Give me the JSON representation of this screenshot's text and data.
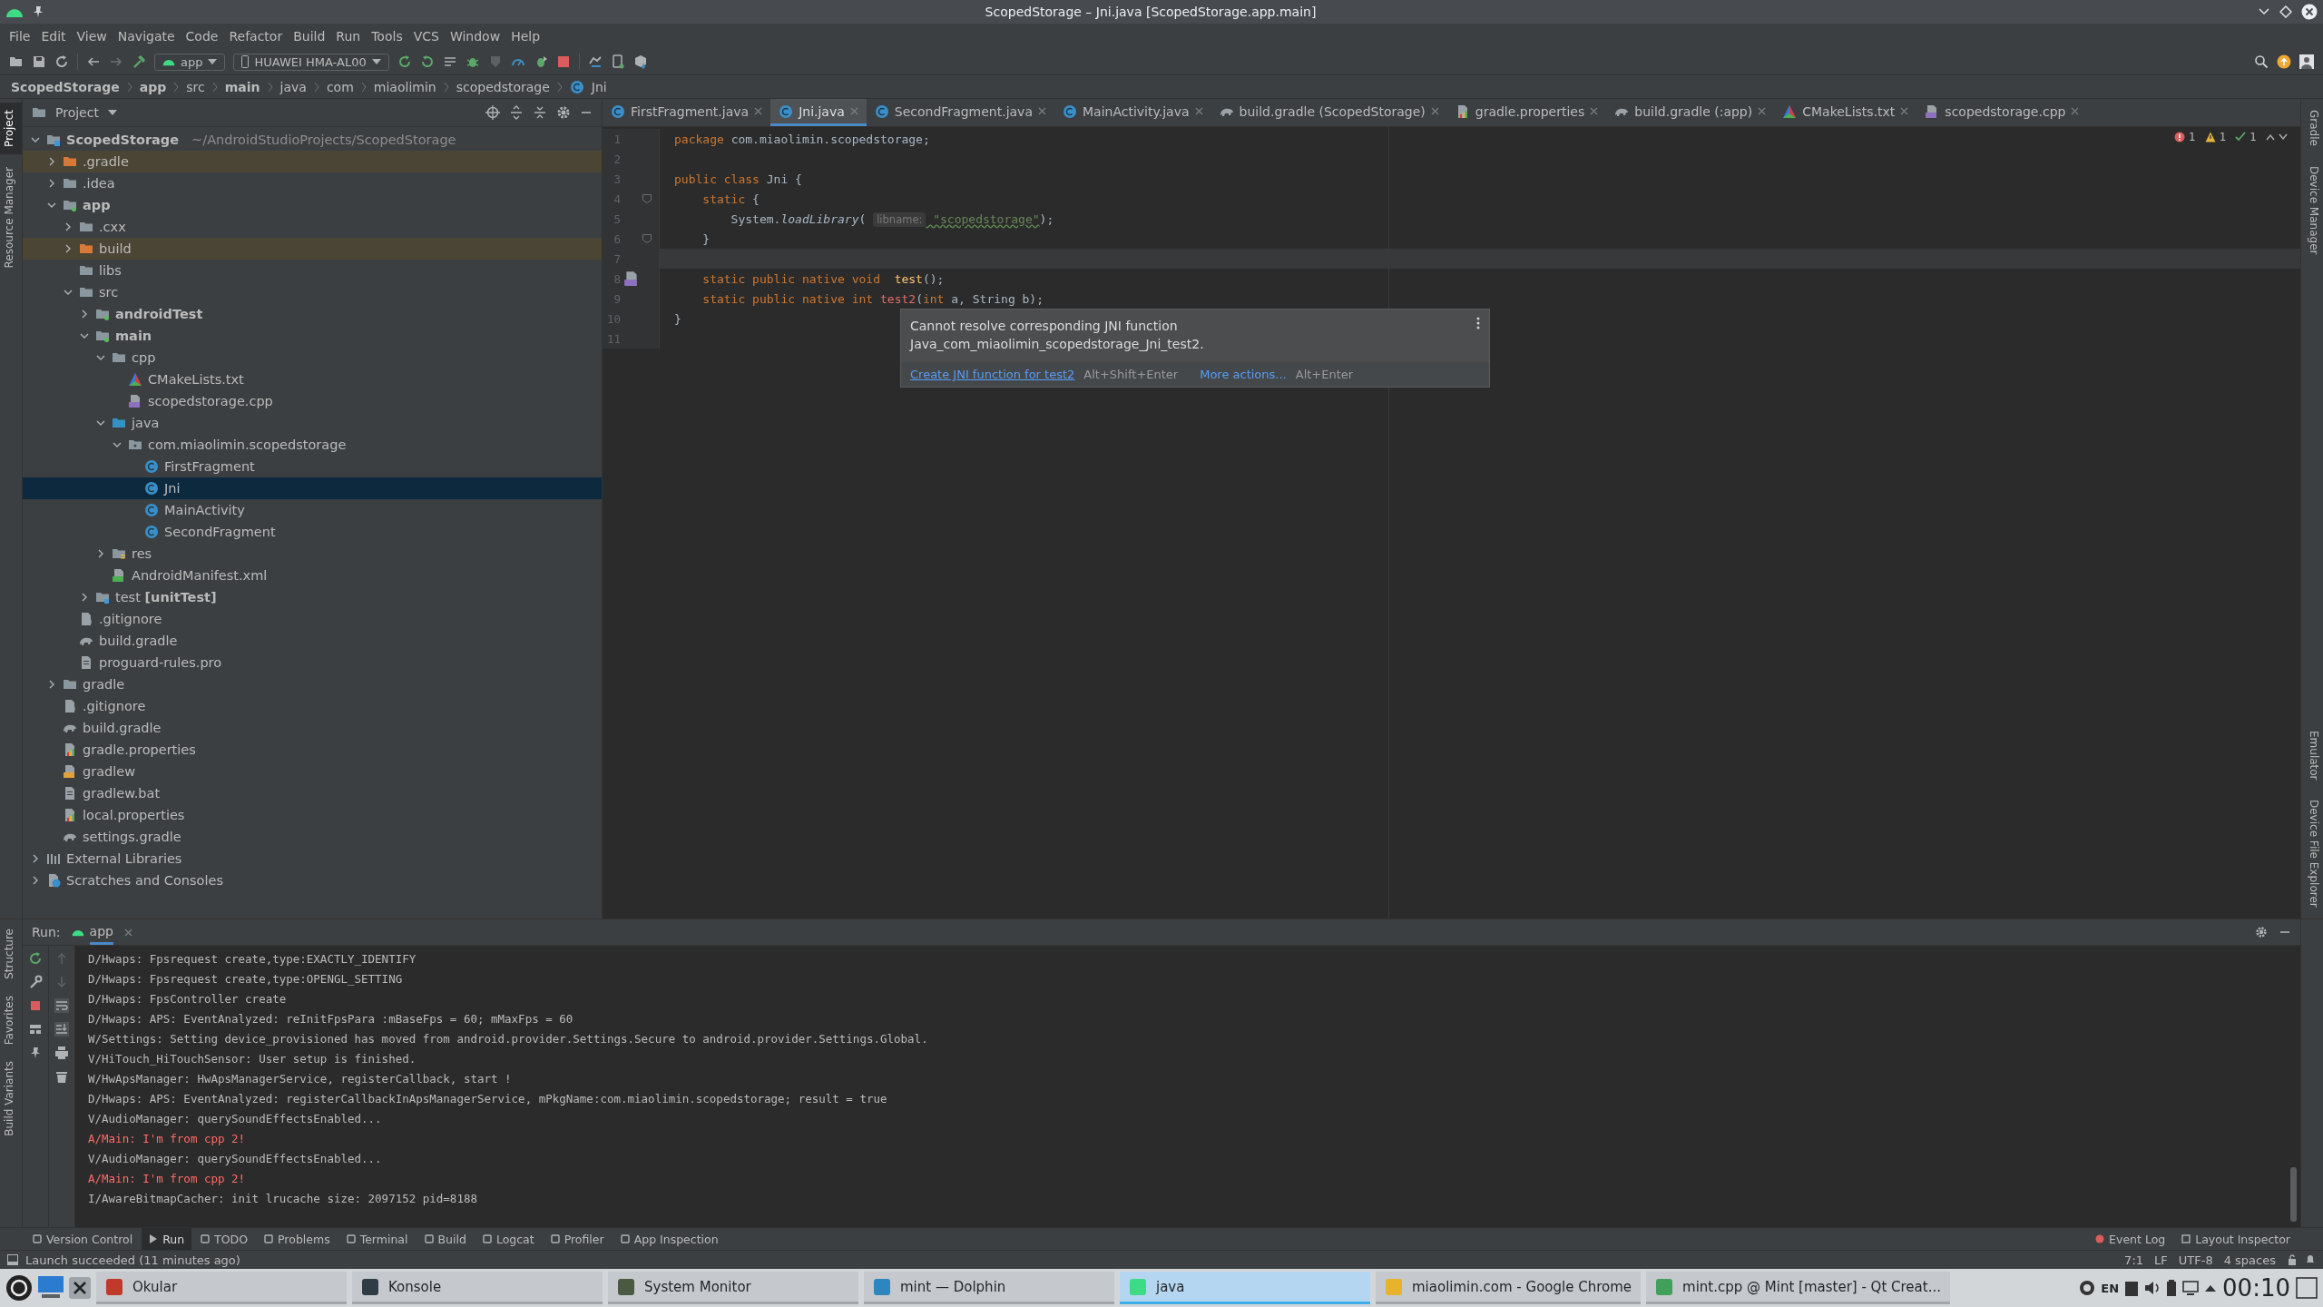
{
  "window": {
    "title": "ScopedStorage – Jni.java [ScopedStorage.app.main]"
  },
  "menu": [
    "File",
    "Edit",
    "View",
    "Navigate",
    "Code",
    "Refactor",
    "Build",
    "Run",
    "Tools",
    "VCS",
    "Window",
    "Help"
  ],
  "toolbar": {
    "run_config": "app",
    "device": "HUAWEI HMA-AL00"
  },
  "breadcrumb": [
    {
      "label": "ScopedStorage",
      "bold": true
    },
    {
      "label": "app",
      "bold": true
    },
    {
      "label": "src",
      "bold": false
    },
    {
      "label": "main",
      "bold": true
    },
    {
      "label": "java",
      "bold": false
    },
    {
      "label": "com",
      "bold": false
    },
    {
      "label": "miaolimin",
      "bold": false
    },
    {
      "label": "scopedstorage",
      "bold": false
    },
    {
      "label": "Jni",
      "bold": false,
      "kind": "class"
    }
  ],
  "left_stripe": {
    "top": [
      {
        "label": "Project",
        "selected": true
      },
      {
        "label": "Resource Manager",
        "selected": false
      }
    ],
    "bottom": [
      {
        "label": "Structure",
        "selected": false
      },
      {
        "label": "Favorites",
        "selected": false
      },
      {
        "label": "Build Variants",
        "selected": false
      }
    ]
  },
  "right_stripe": {
    "top": [
      "Gradle",
      "Device Manager"
    ],
    "bottom": [
      "Emulator",
      "Device File Explorer"
    ]
  },
  "project": {
    "title": "Project",
    "items": [
      {
        "label": "ScopedStorage",
        "hint": "~/AndroidStudioProjects/ScopedStorage",
        "kind": "module",
        "bold": true,
        "expanded": true,
        "selected": false,
        "children": [
          {
            "label": ".gradle",
            "kind": "folder-excluded",
            "excluded": true,
            "expanded": false,
            "selected": false
          },
          {
            "label": ".idea",
            "kind": "folder",
            "expanded": false,
            "selected": false
          },
          {
            "label": "app",
            "kind": "module-source",
            "bold": true,
            "expanded": true,
            "selected": false,
            "children": [
              {
                "label": ".cxx",
                "kind": "folder",
                "expanded": false,
                "selected": false
              },
              {
                "label": "build",
                "kind": "folder-excluded",
                "excluded": true,
                "expanded": false,
                "selected": false
              },
              {
                "label": "libs",
                "kind": "folder",
                "selected": false
              },
              {
                "label": "src",
                "kind": "folder",
                "expanded": true,
                "selected": false,
                "children": [
                  {
                    "label": "androidTest",
                    "kind": "module-source",
                    "bold": true,
                    "expanded": false,
                    "selected": false
                  },
                  {
                    "label": "main",
                    "kind": "module-source",
                    "bold": true,
                    "expanded": true,
                    "selected": false,
                    "children": [
                      {
                        "label": "cpp",
                        "kind": "folder",
                        "expanded": true,
                        "selected": false,
                        "children": [
                          {
                            "label": "CMakeLists.txt",
                            "kind": "cmake",
                            "selected": false
                          },
                          {
                            "label": "scopedstorage.cpp",
                            "kind": "cpp",
                            "selected": false
                          }
                        ]
                      },
                      {
                        "label": "java",
                        "kind": "folder-source",
                        "expanded": true,
                        "selected": false,
                        "children": [
                          {
                            "label": "com.miaolimin.scopedstorage",
                            "kind": "package",
                            "expanded": true,
                            "selected": false,
                            "children": [
                              {
                                "label": "FirstFragment",
                                "kind": "class",
                                "selected": false
                              },
                              {
                                "label": "Jni",
                                "kind": "class",
                                "selected": true
                              },
                              {
                                "label": "MainActivity",
                                "kind": "class",
                                "selected": false
                              },
                              {
                                "label": "SecondFragment",
                                "kind": "class",
                                "selected": false
                              }
                            ]
                          }
                        ]
                      },
                      {
                        "label": "res",
                        "kind": "folder-res",
                        "expanded": false,
                        "selected": false
                      },
                      {
                        "label": "AndroidManifest.xml",
                        "kind": "manifest",
                        "selected": false
                      }
                    ]
                  },
                  {
                    "label": "test **[unitTest]**",
                    "kind": "module-test",
                    "expanded": false,
                    "selected": false
                  }
                ]
              },
              {
                "label": ".gitignore",
                "kind": "ignore",
                "selected": false
              },
              {
                "label": "build.gradle",
                "kind": "gradle",
                "selected": false
              },
              {
                "label": "proguard-rules.pro",
                "kind": "text",
                "selected": false
              }
            ]
          },
          {
            "label": "gradle",
            "kind": "folder",
            "expanded": false,
            "selected": false
          },
          {
            "label": ".gitignore",
            "kind": "ignore",
            "selected": false
          },
          {
            "label": "build.gradle",
            "kind": "gradle",
            "selected": false
          },
          {
            "label": "gradle.properties",
            "kind": "properties",
            "selected": false
          },
          {
            "label": "gradlew",
            "kind": "shell",
            "selected": false
          },
          {
            "label": "gradlew.bat",
            "kind": "text",
            "selected": false
          },
          {
            "label": "local.properties",
            "kind": "properties",
            "selected": false
          },
          {
            "label": "settings.gradle",
            "kind": "gradle",
            "selected": false
          }
        ]
      },
      {
        "label": "External Libraries",
        "kind": "libraries",
        "expanded": false,
        "selected": false
      },
      {
        "label": "Scratches and Consoles",
        "kind": "scratches",
        "expanded": false,
        "selected": false
      }
    ]
  },
  "tabs": [
    {
      "label": "FirstFragment.java",
      "kind": "class",
      "selected": false
    },
    {
      "label": "Jni.java",
      "kind": "class",
      "selected": true
    },
    {
      "label": "SecondFragment.java",
      "kind": "class",
      "selected": false
    },
    {
      "label": "MainActivity.java",
      "kind": "class",
      "selected": false
    },
    {
      "label": "build.gradle (ScopedStorage)",
      "kind": "gradle",
      "selected": false
    },
    {
      "label": "gradle.properties",
      "kind": "properties",
      "selected": false
    },
    {
      "label": "build.gradle (:app)",
      "kind": "gradle",
      "selected": false
    },
    {
      "label": "CMakeLists.txt",
      "kind": "cmake",
      "selected": false
    },
    {
      "label": "scopedstorage.cpp",
      "kind": "cpp",
      "selected": false
    }
  ],
  "inspections": {
    "errors": "1",
    "warnings": "1",
    "weak_warnings": "1"
  },
  "code": [
    {
      "number": "1",
      "tokens": [
        {
          "kind": "keyword",
          "text": "package "
        },
        {
          "kind": "plain",
          "text": "com.miaolimin.scopedstorage;"
        }
      ]
    },
    {
      "number": "2"
    },
    {
      "number": "3",
      "tokens": [
        {
          "kind": "keyword",
          "text": "public class "
        },
        {
          "kind": "plain",
          "text": "Jni {"
        }
      ]
    },
    {
      "number": "4",
      "fold": true,
      "tokens": [
        {
          "kind": "keyword",
          "text": "    static "
        },
        {
          "kind": "plain",
          "text": "{"
        }
      ]
    },
    {
      "number": "5",
      "tokens": [
        {
          "kind": "plain",
          "text": "        System."
        },
        {
          "kind": "static-call",
          "text": "loadLibrary"
        },
        {
          "kind": "plain",
          "text": "( "
        },
        {
          "kind": "hint",
          "text": "libname:"
        },
        {
          "kind": "string",
          "text": " \"scopedstorage\""
        },
        {
          "kind": "plain",
          "text": ");"
        }
      ]
    },
    {
      "number": "6",
      "fold": true,
      "tokens": [
        {
          "kind": "plain",
          "text": "    }"
        }
      ]
    },
    {
      "number": "7",
      "current": true
    },
    {
      "number": "8",
      "native_marker": true,
      "tokens": [
        {
          "kind": "keyword",
          "text": "    static public native void  "
        },
        {
          "kind": "function",
          "text": "test"
        },
        {
          "kind": "plain",
          "text": "();"
        }
      ]
    },
    {
      "number": "9",
      "tokens": [
        {
          "kind": "keyword",
          "text": "    static public native int "
        },
        {
          "kind": "error",
          "text": "test2"
        },
        {
          "kind": "plain",
          "text": "("
        },
        {
          "kind": "keyword",
          "text": "int "
        },
        {
          "kind": "plain",
          "text": "a, String b);"
        }
      ]
    },
    {
      "number": "10",
      "tokens": [
        {
          "kind": "plain",
          "text": "}"
        }
      ]
    },
    {
      "number": "11"
    }
  ],
  "popup": {
    "message": [
      "Cannot resolve corresponding JNI function",
      "Java_com_miaolimin_scopedstorage_Jni_test2."
    ],
    "actions": [
      {
        "label": "Create JNI function for test2",
        "shortcut": "Alt+Shift+Enter"
      },
      {
        "label": "More actions...",
        "shortcut": "Alt+Enter"
      }
    ]
  },
  "run": {
    "label": "Run:",
    "tab": "app",
    "log": [
      {
        "kind": "info",
        "text": "D/Hwaps: Fpsrequest create,type:EXACTLY_IDENTIFY"
      },
      {
        "kind": "info",
        "text": "D/Hwaps: Fpsrequest create,type:OPENGL_SETTING"
      },
      {
        "kind": "info",
        "text": "D/Hwaps: FpsController create"
      },
      {
        "kind": "info",
        "text": "D/Hwaps: APS: EventAnalyzed: reInitFpsPara :mBaseFps = 60; mMaxFps = 60"
      },
      {
        "kind": "info",
        "text": "W/Settings: Setting device_provisioned has moved from android.provider.Settings.Secure to android.provider.Settings.Global."
      },
      {
        "kind": "info",
        "text": "V/HiTouch_HiTouchSensor: User setup is finished."
      },
      {
        "kind": "info",
        "text": "W/HwApsManager: HwApsManagerService, registerCallback, start !"
      },
      {
        "kind": "info",
        "text": "D/Hwaps: APS: EventAnalyzed: registerCallbackInApsManagerService, mPkgName:com.miaolimin.scopedstorage; result = true"
      },
      {
        "kind": "info",
        "text": "V/AudioManager: querySoundEffectsEnabled..."
      },
      {
        "kind": "error",
        "text": "A/Main: I'm from cpp 2!"
      },
      {
        "kind": "info",
        "text": "V/AudioManager: querySoundEffectsEnabled..."
      },
      {
        "kind": "error",
        "text": "A/Main: I'm from cpp 2!"
      },
      {
        "kind": "info",
        "text": "I/AwareBitmapCacher: init lrucache size: 2097152 pid=8188"
      }
    ]
  },
  "tool_tabs": [
    {
      "label": "Version Control",
      "selected": false
    },
    {
      "label": "Run",
      "selected": true
    },
    {
      "label": "TODO",
      "selected": false
    },
    {
      "label": "Problems",
      "selected": false
    },
    {
      "label": "Terminal",
      "selected": false
    },
    {
      "label": "Build",
      "selected": false
    },
    {
      "label": "Logcat",
      "selected": false
    },
    {
      "label": "Profiler",
      "selected": false
    },
    {
      "label": "App Inspection",
      "selected": false
    }
  ],
  "tool_tabs_right": [
    "Event Log",
    "Layout Inspector"
  ],
  "status_bar": {
    "message": "Launch succeeded (11 minutes ago)",
    "items": [
      "7:1",
      "LF",
      "UTF-8",
      "4 spaces"
    ]
  },
  "taskbar": {
    "items": [
      {
        "label": "Okular",
        "selected": false
      },
      {
        "label": "Konsole",
        "selected": false
      },
      {
        "label": "System Monitor",
        "selected": false
      },
      {
        "label": "mint — Dolphin",
        "selected": false
      },
      {
        "label": "java",
        "selected": true
      },
      {
        "label": "miaolimin.com - Google Chrome",
        "selected": false
      },
      {
        "label": "mint.cpp @ Mint [master] - Qt Creat...",
        "selected": false
      }
    ],
    "language": "EN",
    "time": "00:10"
  }
}
